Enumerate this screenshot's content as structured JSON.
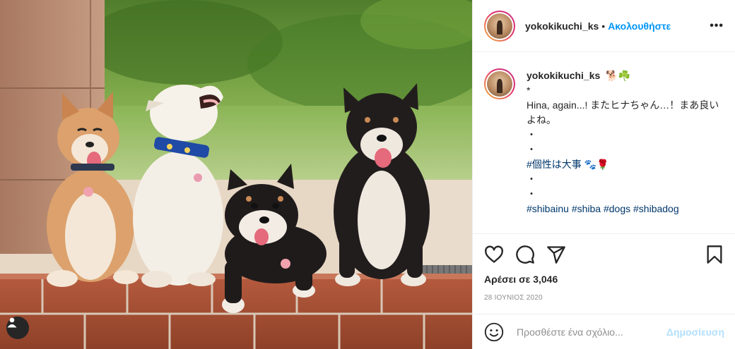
{
  "post": {
    "username": "yokokikuchi_ks",
    "follow_label": "Ακολουθήστε",
    "more_label": "•••",
    "photo_alt": "Four Shiba Inu dogs sitting on a brick ledge"
  },
  "caption": {
    "username": "yokokikuchi_ks",
    "emojis": "🐕☘️",
    "lines": [
      "*",
      "",
      "Hina, again...! またヒナちゃん…！まあ良いよね。",
      "・",
      "・",
      "#個性は大事 🐾🌹",
      "・",
      "・",
      "",
      "#shibainu #shiba #dogs #shibadog"
    ]
  },
  "actions": {
    "likes_label": "Αρέσει σε 3,046",
    "date": "28 ΙΟΥΝΙΟΣ 2020"
  },
  "comment": {
    "placeholder": "Προσθέστε ένα σχόλιο...",
    "post_label": "Δημοσίευση"
  },
  "colors": {
    "link": "#0095f6",
    "hashtag": "#00376b",
    "post_disabled": "#b2dffc",
    "muted": "#8e8e8e"
  },
  "icons": [
    "heart-icon",
    "comment-icon",
    "share-icon",
    "bookmark-icon",
    "emoji-icon",
    "user-tag-icon",
    "more-icon"
  ]
}
